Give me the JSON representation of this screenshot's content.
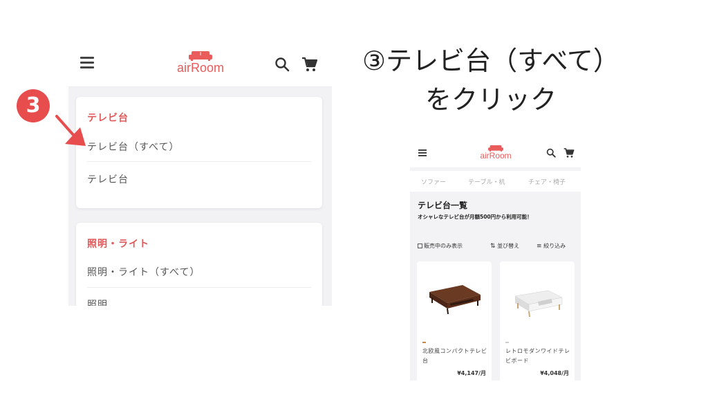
{
  "instruction": {
    "line1": "③テレビ台（すべて）",
    "line2": "をクリック"
  },
  "step_marker": "3",
  "left_screen": {
    "logo": "airRoom",
    "menu": [
      {
        "category": "テレビ台",
        "items": [
          "テレビ台（すべて）",
          "テレビ台"
        ]
      },
      {
        "category": "照明・ライト",
        "items": [
          "照明・ライト（すべて）",
          "照明"
        ]
      }
    ]
  },
  "right_screen": {
    "logo": "airRoom",
    "tabs": [
      "ソファー",
      "テーブル・机",
      "チェア・椅子"
    ],
    "list_title": "テレビ台一覧",
    "list_subtitle": "オシャレなテレビ台が月額500円から利用可能！",
    "filters": {
      "on_sale_only": "販売中のみ表示",
      "sort": "並び替え",
      "narrow": "絞り込み"
    },
    "products": [
      {
        "name": "北欧風コンパクトテレビ台",
        "price": "¥4,147/月",
        "tag_color": "#c8893a"
      },
      {
        "name": "レトロモダンワイドテレビボード",
        "price": "¥4,048/月",
        "tag_color": "#cccccc"
      }
    ]
  },
  "colors": {
    "accent": "#e0595a",
    "logo": "#ea5b5b",
    "step_marker": "#e84d4d"
  }
}
